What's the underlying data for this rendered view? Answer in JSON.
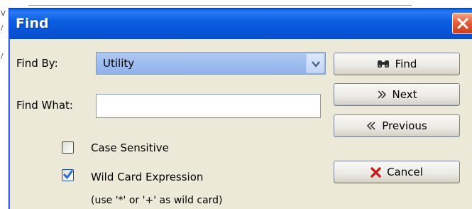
{
  "background": {
    "glyphs": [
      "V",
      "/",
      "/"
    ]
  },
  "dialog": {
    "title": "Find",
    "close_icon": "close-icon"
  },
  "find_by": {
    "label": "Find By:",
    "selected": "Utility"
  },
  "find_what": {
    "label": "Find What:",
    "value": ""
  },
  "options": {
    "case_sensitive": {
      "label": "Case Sensitive",
      "checked": false
    },
    "wild_card": {
      "label": "Wild Card Expression",
      "checked": true
    },
    "wild_card_hint": "(use '*' or '+' as wild card)"
  },
  "buttons": {
    "find": {
      "label": "Find",
      "icon": "binoculars-icon"
    },
    "next": {
      "label": "Next",
      "icon": "chevron-double-right-icon"
    },
    "previous": {
      "label": "Previous",
      "icon": "chevron-double-left-icon"
    },
    "cancel": {
      "label": "Cancel",
      "icon": "red-x-icon"
    }
  },
  "colors": {
    "titlebar": "#0a5ce5",
    "close_button": "#e2603a",
    "dialog_face": "#ece9d8",
    "select_highlight": "#9dbcee",
    "checkbox_check": "#2a6fc9",
    "cancel_x": "#d11b1b"
  }
}
